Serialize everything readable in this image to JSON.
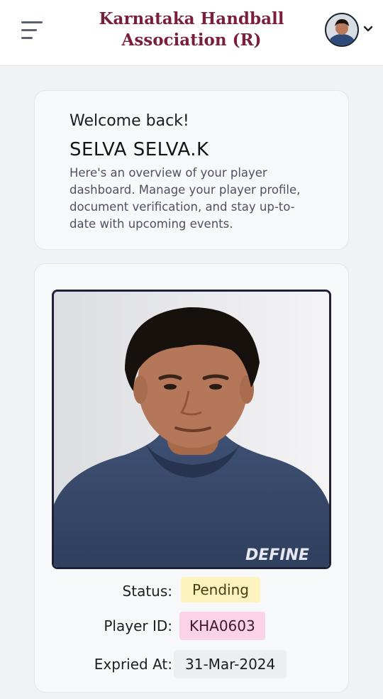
{
  "header": {
    "title_line1": "Karnataka Handball",
    "title_line2": "Association (R)",
    "menu_icon": "hamburger-menu-icon",
    "avatar_icon": "user-avatar",
    "chevron_icon": "chevron-down-icon"
  },
  "welcome": {
    "greeting": "Welcome back!",
    "player_name": "SELVA SELVA.K",
    "description": "Here's an overview of your player dashboard. Manage your player profile, document verification, and stay up-to-date with upcoming events."
  },
  "profile": {
    "photo_text": "DEFINE",
    "status_label": "Status:",
    "status_value": "Pending",
    "player_id_label": "Player ID:",
    "player_id_value": "KHA0603",
    "expiry_label": "Expried At:",
    "expiry_value": "31-Mar-2024"
  },
  "colors": {
    "brand": "#7a1f3b",
    "status_pending_bg": "#fcf3bf",
    "player_id_bg": "#fbd3e6",
    "expiry_bg": "#eceef1"
  }
}
